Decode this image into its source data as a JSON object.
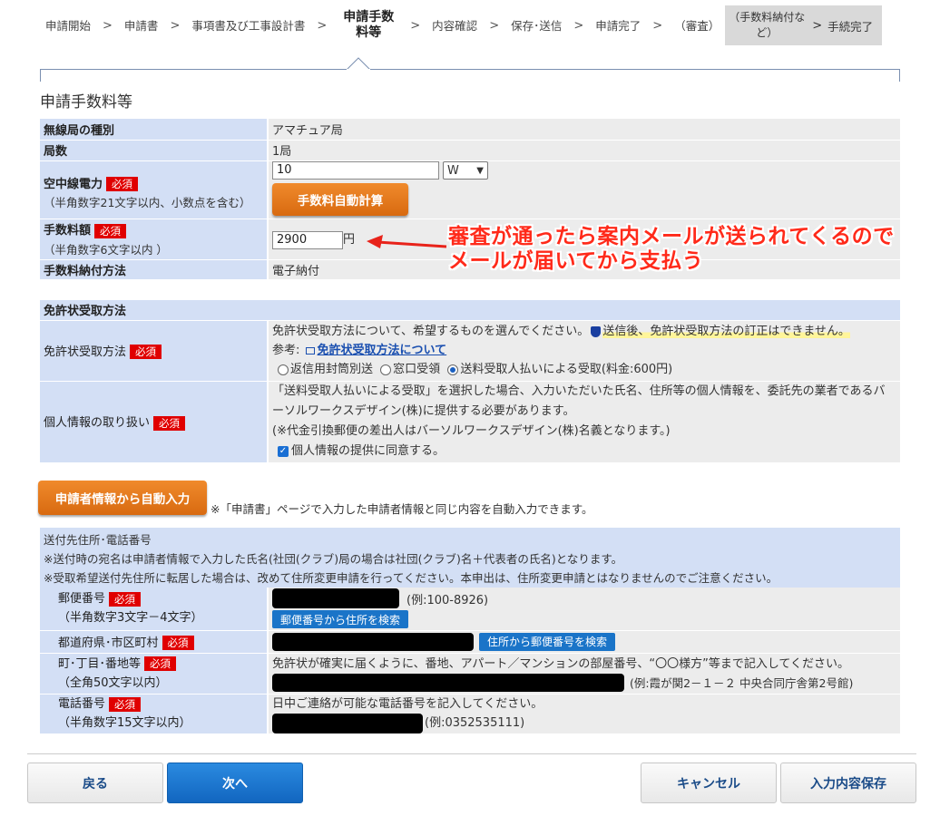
{
  "steps": [
    {
      "label": "申請開始"
    },
    {
      "label": "申請書"
    },
    {
      "label": "事項書及び工事設計書"
    },
    {
      "label": "申請手数料等",
      "current": true
    },
    {
      "label": "内容確認"
    },
    {
      "label": "保存･送信"
    },
    {
      "label": "申請完了"
    },
    {
      "label": "（審査）"
    },
    {
      "label": "（手数料納付など）",
      "gray": true
    },
    {
      "label": "手続完了",
      "gray": true
    }
  ],
  "chevron": ">",
  "page_title": "申請手数料等",
  "fee": {
    "station_type_label": "無線局の種別",
    "station_type_value": "アマチュア局",
    "count_label": "局数",
    "count_value": "1局",
    "power_label": "空中線電力",
    "power_hint": "（半角数字21文字以内、小数点を含む）",
    "power_value": "10",
    "power_unit": "W",
    "auto_calc_button": "手数料自動計算",
    "amount_label": "手数料額",
    "amount_hint": "（半角数字6文字以内 ）",
    "amount_value": "2900",
    "amount_unit": "円",
    "payment_label": "手数料納付方法",
    "payment_value": "電子納付"
  },
  "required": "必須",
  "annotation": {
    "line1": "審査が通ったら案内メールが送られてくるので",
    "line2": "メールが届いてから支払う"
  },
  "license": {
    "section_title": "免許状受取方法",
    "method_label": "免許状受取方法",
    "method_intro": "免許状受取方法について、希望するものを選んでください。",
    "method_warning": "送信後、免許状受取方法の訂正はできません。",
    "ref_label": "参考:",
    "ref_link": "免許状受取方法について",
    "options": [
      "返信用封筒別送",
      "窓口受領",
      "送料受取人払いによる受取(料金:600円)"
    ],
    "privacy_label": "個人情報の取り扱い",
    "privacy_text1": "「送料受取人払いによる受取」を選択した場合、入力いただいた氏名、住所等の個人情報を、委託先の業者であるバーソルワークスデザイン(株)に提供する必要があります。",
    "privacy_text2": "(※代金引換郵便の差出人はバーソルワークスデザイン(株)名義となります。)",
    "privacy_agree": "個人情報の提供に同意する。"
  },
  "autofill": {
    "button": "申請者情報から自動入力",
    "note": "※「申請書」ページで入力した申請者情報と同じ内容を自動入力できます。"
  },
  "address": {
    "header": "送付先住所･電話番号",
    "note1": "※送付時の宛名は申請者情報で入力した氏名(社団(クラブ)局の場合は社団(クラブ)名＋代表者の氏名)となります。",
    "note2": "※受取希望送付先住所に転居した場合は、改めて住所変更申請を行ってください。本申出は、住所変更申請とはなりませんのでご注意ください。",
    "postal_label": "郵便番号",
    "postal_hint": "（半角数字3文字－4文字）",
    "postal_example": "(例:100-8926)",
    "postal_search": "郵便番号から住所を検索",
    "pref_label": "都道府県･市区町村",
    "pref_search": "住所から郵便番号を検索",
    "street_label": "町･丁目･番地等",
    "street_hint": "（全角50文字以内）",
    "street_note": "免許状が確実に届くように、番地、アパート／マンションの部屋番号、“〇〇様方”等まで記入してください。",
    "street_example": "(例:霞が関2－１－２ 中央合同庁舎第2号館)",
    "phone_label": "電話番号",
    "phone_hint": "（半角数字15文字以内）",
    "phone_note": "日中ご連絡が可能な電話番号を記入してください。",
    "phone_example": "(例:0352535111)"
  },
  "footer": {
    "back": "戻る",
    "next": "次へ",
    "cancel": "キャンセル",
    "save": "入力内容保存"
  },
  "colors": {
    "header_bg": "#d3dff5",
    "cell_bg": "#ececec",
    "required_bg": "#e00000",
    "orange": "#e87b1e",
    "blue": "#1a74c8",
    "annotation": "#ff2a1a"
  }
}
